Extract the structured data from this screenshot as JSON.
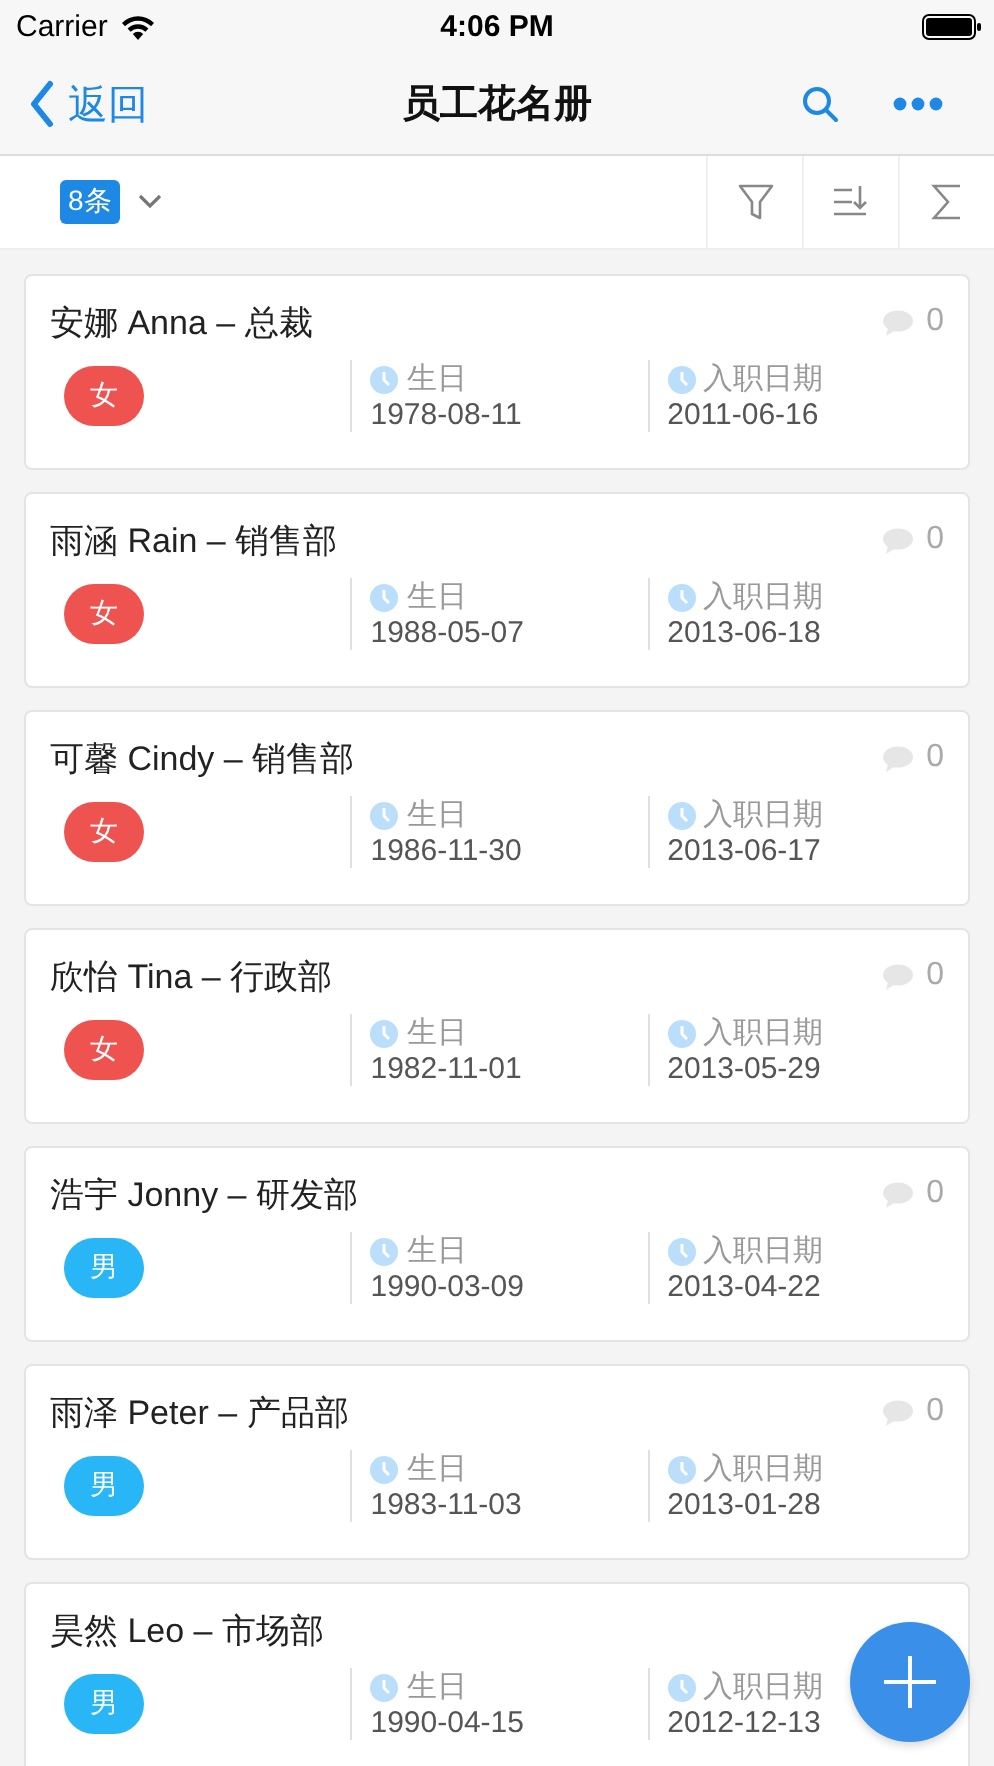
{
  "status_bar": {
    "carrier": "Carrier",
    "time": "4:06 PM"
  },
  "nav": {
    "back": "返回",
    "title": "员工花名册"
  },
  "toolbar": {
    "count": "8条"
  },
  "employees": [
    {
      "title": "安娜 Anna – 总裁",
      "comments": "0",
      "gender": "女",
      "color": "#ef5350",
      "birthday_label": "生日",
      "birthday": "1978-08-11",
      "hire_label": "入职日期",
      "hire_date": "2011-06-16"
    },
    {
      "title": "雨涵 Rain – 销售部",
      "comments": "0",
      "gender": "女",
      "color": "#ef5350",
      "birthday_label": "生日",
      "birthday": "1988-05-07",
      "hire_label": "入职日期",
      "hire_date": "2013-06-18"
    },
    {
      "title": "可馨 Cindy – 销售部",
      "comments": "0",
      "gender": "女",
      "color": "#ef5350",
      "birthday_label": "生日",
      "birthday": "1986-11-30",
      "hire_label": "入职日期",
      "hire_date": "2013-06-17"
    },
    {
      "title": "欣怡 Tina – 行政部",
      "comments": "0",
      "gender": "女",
      "color": "#ef5350",
      "birthday_label": "生日",
      "birthday": "1982-11-01",
      "hire_label": "入职日期",
      "hire_date": "2013-05-29"
    },
    {
      "title": "浩宇 Jonny – 研发部",
      "comments": "0",
      "gender": "男",
      "color": "#29b6f6",
      "birthday_label": "生日",
      "birthday": "1990-03-09",
      "hire_label": "入职日期",
      "hire_date": "2013-04-22"
    },
    {
      "title": "雨泽 Peter – 产品部",
      "comments": "0",
      "gender": "男",
      "color": "#29b6f6",
      "birthday_label": "生日",
      "birthday": "1983-11-03",
      "hire_label": "入职日期",
      "hire_date": "2013-01-28"
    },
    {
      "title": "昊然 Leo – 市场部",
      "gender": "男",
      "color": "#29b6f6",
      "birthday_label": "生日",
      "birthday": "1990-04-15",
      "hire_label": "入职日期",
      "hire_date": "2012-12-13"
    }
  ]
}
